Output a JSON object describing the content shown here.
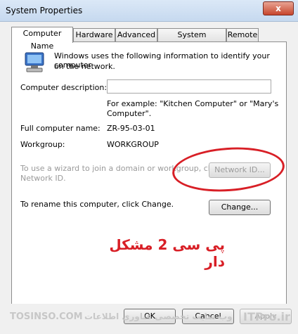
{
  "window": {
    "title": "System Properties",
    "close_glyph": "x"
  },
  "tabs": [
    "Computer Name",
    "Hardware",
    "Advanced",
    "System Protection",
    "Remote"
  ],
  "computer_name_tab": {
    "intro_line1": "Windows uses the following information to identify your computer",
    "intro_line2": "on the network.",
    "description_label": "Computer description:",
    "description_value": "",
    "example_line1": "For example: \"Kitchen Computer\" or \"Mary's",
    "example_line2": "Computer\".",
    "full_name_label": "Full computer name:",
    "full_name_value": "ZR-95-03-01",
    "workgroup_label": "Workgroup:",
    "workgroup_value": "WORKGROUP",
    "wizard_line1": "To use a wizard to join a domain or workgroup, click",
    "wizard_line2": "Network ID.",
    "network_id_button": "Network ID...",
    "rename_text": "To rename this computer, click Change.",
    "change_button": "Change..."
  },
  "annotation": {
    "persian_text": "پی سی 2 مشکل دار",
    "color": "#d81f26"
  },
  "footer": {
    "ok_button": "OK",
    "cancel_button": "Cancel",
    "apply_button": "Apply"
  },
  "watermarks": {
    "left": "TOSINSO.COM",
    "middle": "وب سایت تخصصی فناوری اطلاعات",
    "right": "ITPro.ir"
  },
  "icons": {
    "computer": "computer-icon"
  }
}
